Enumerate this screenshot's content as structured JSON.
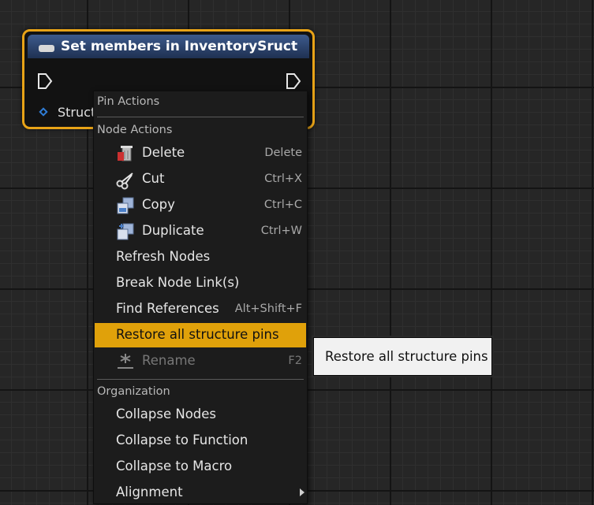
{
  "node": {
    "title": "Set members in InventorySruct",
    "struct_pin_label": "Struct"
  },
  "menu": {
    "pin_actions_header": "Pin Actions",
    "node_actions_header": "Node Actions",
    "organization_header": "Organization",
    "items": [
      {
        "label": "Delete",
        "shortcut": "Delete",
        "icon": "delete-icon"
      },
      {
        "label": "Cut",
        "shortcut": "Ctrl+X",
        "icon": "cut-icon"
      },
      {
        "label": "Copy",
        "shortcut": "Ctrl+C",
        "icon": "copy-icon"
      },
      {
        "label": "Duplicate",
        "shortcut": "Ctrl+W",
        "icon": "duplicate-icon"
      },
      {
        "label": "Refresh Nodes",
        "shortcut": ""
      },
      {
        "label": "Break Node Link(s)",
        "shortcut": ""
      },
      {
        "label": "Find References",
        "shortcut": "Alt+Shift+F"
      },
      {
        "label": "Restore all structure pins",
        "shortcut": "",
        "highlighted": true
      },
      {
        "label": "Rename",
        "shortcut": "F2",
        "icon": "rename-icon",
        "disabled": true
      }
    ],
    "org_items": [
      {
        "label": "Collapse Nodes"
      },
      {
        "label": "Collapse to Function"
      },
      {
        "label": "Collapse to Macro"
      },
      {
        "label": "Alignment",
        "submenu": true
      }
    ]
  },
  "tooltip": {
    "text": "Restore all structure pins"
  },
  "colors": {
    "accent": "#e0a10a",
    "node_border": "#e8a317",
    "node_header": "#3c5a8c",
    "struct_pin": "#2f7dd6"
  }
}
